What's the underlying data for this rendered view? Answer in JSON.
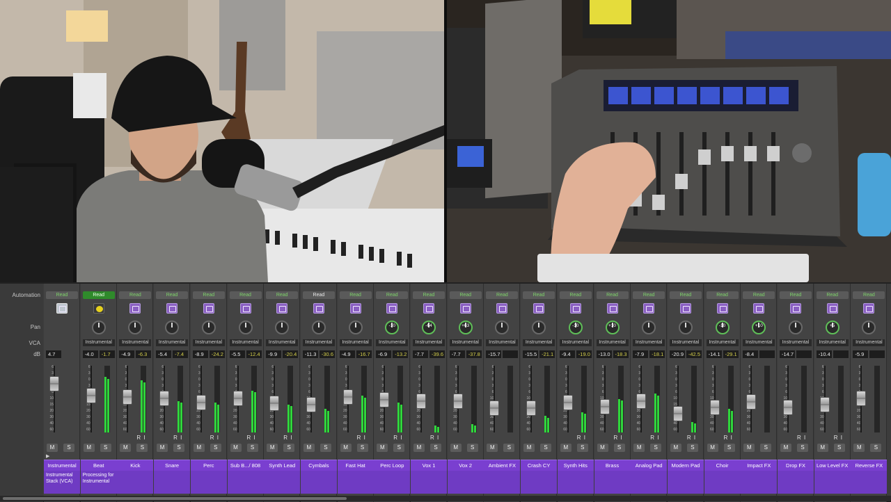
{
  "labels": {
    "automation": "Automation",
    "pan": "Pan",
    "vca": "VCA",
    "db": "dB"
  },
  "scale": [
    "6",
    "3",
    "0",
    "3",
    "6",
    "10",
    "15",
    "20",
    "30",
    "40",
    "60"
  ],
  "channels": [
    {
      "name": "Instrumental",
      "auto": "Read",
      "auto_style": "green-text",
      "plugin": "stack",
      "pan": "",
      "vca": "",
      "db1": "4.7",
      "db2": "",
      "fader": 0.27,
      "meter": [
        0,
        0
      ],
      "ri": false,
      "note": "Instrumental Stack (VCA)"
    },
    {
      "name": "Beat",
      "auto": "Read",
      "auto_style": "green-bg",
      "plugin": "beat",
      "pan": "",
      "vca": "Instrumental",
      "db1": "-4.0",
      "db2": "-1.7",
      "fader": 0.45,
      "meter": [
        0.83,
        0.8
      ],
      "ri": false,
      "note": "Processing for Instrumental"
    },
    {
      "name": "Kick",
      "auto": "Read",
      "auto_style": "green-text",
      "plugin": "plugin",
      "pan": "",
      "vca": "Instrumental",
      "db1": "-4.9",
      "db2": "-6.3",
      "fader": 0.47,
      "meter": [
        0.78,
        0.75
      ],
      "ri": true,
      "note": ""
    },
    {
      "name": "Snare",
      "auto": "Read",
      "auto_style": "green-text",
      "plugin": "plugin",
      "pan": "",
      "vca": "Instrumental",
      "db1": "-5.4",
      "db2": "-7.4",
      "fader": 0.49,
      "meter": [
        0.47,
        0.45
      ],
      "ri": true,
      "note": ""
    },
    {
      "name": "Perc",
      "auto": "Read",
      "auto_style": "green-text",
      "plugin": "plugin",
      "pan": "",
      "vca": "Instrumental",
      "db1": "-8.9",
      "db2": "-24.2",
      "fader": 0.55,
      "meter": [
        0.45,
        0.42
      ],
      "ri": true,
      "note": ""
    },
    {
      "name": "Sub B.../ 808",
      "auto": "Read",
      "auto_style": "green-text",
      "plugin": "plugin",
      "pan": "",
      "vca": "Instrumental",
      "db1": "-5.5",
      "db2": "-12.4",
      "fader": 0.49,
      "meter": [
        0.62,
        0.6
      ],
      "ri": true,
      "note": ""
    },
    {
      "name": "Synth Lead",
      "auto": "Read",
      "auto_style": "green-text",
      "plugin": "plugin",
      "pan": "",
      "vca": "Instrumental",
      "db1": "-9.9",
      "db2": "-20.4",
      "fader": 0.56,
      "meter": [
        0.42,
        0.4
      ],
      "ri": true,
      "note": ""
    },
    {
      "name": "Cymbals",
      "auto": "Read",
      "auto_style": "white",
      "plugin": "plugin",
      "pan": "",
      "vca": "Instrumental",
      "db1": "-11.3",
      "db2": "-30.6",
      "fader": 0.58,
      "meter": [
        0.35,
        0.32
      ],
      "ri": false,
      "note": ""
    },
    {
      "name": "Fast Hat",
      "auto": "Read",
      "auto_style": "green-text",
      "plugin": "plugin",
      "pan": "",
      "vca": "Instrumental",
      "db1": "-4.9",
      "db2": "-16.7",
      "fader": 0.47,
      "meter": [
        0.55,
        0.52
      ],
      "ri": true,
      "note": ""
    },
    {
      "name": "Perc Loop",
      "auto": "Read",
      "auto_style": "green-text",
      "plugin": "plugin",
      "pan": "-10",
      "vca": "Instrumental",
      "db1": "-6.9",
      "db2": "-13.2",
      "fader": 0.51,
      "meter": [
        0.45,
        0.42
      ],
      "ri": true,
      "note": ""
    },
    {
      "name": "Vox 1",
      "auto": "Read",
      "auto_style": "green-text",
      "plugin": "plugin",
      "pan": "-64",
      "vca": "Instrumental",
      "db1": "-7.7",
      "db2": "-39.6",
      "fader": 0.53,
      "meter": [
        0.1,
        0.08
      ],
      "ri": true,
      "note": ""
    },
    {
      "name": "Vox 2",
      "auto": "Read",
      "auto_style": "green-text",
      "plugin": "plugin",
      "pan": "+63",
      "vca": "Instrumental",
      "db1": "-7.7",
      "db2": "-37.8",
      "fader": 0.53,
      "meter": [
        0.12,
        0.1
      ],
      "ri": false,
      "note": ""
    },
    {
      "name": "Ambient FX",
      "auto": "Read",
      "auto_style": "green-text",
      "plugin": "plugin",
      "pan": "",
      "vca": "Instrumental",
      "db1": "-15.7",
      "db2": "",
      "fader": 0.64,
      "meter": [
        0,
        0
      ],
      "ri": false,
      "note": ""
    },
    {
      "name": "Crash CY",
      "auto": "Read",
      "auto_style": "green-text",
      "plugin": "plugin",
      "pan": "",
      "vca": "Instrumental",
      "db1": "-15.5",
      "db2": "-21.1",
      "fader": 0.64,
      "meter": [
        0.25,
        0.22
      ],
      "ri": false,
      "note": ""
    },
    {
      "name": "Synth Hits",
      "auto": "Read",
      "auto_style": "green-text",
      "plugin": "plugin",
      "pan": "-10",
      "vca": "Instrumental",
      "db1": "-9.4",
      "db2": "-19.0",
      "fader": 0.55,
      "meter": [
        0.3,
        0.28
      ],
      "ri": true,
      "note": ""
    },
    {
      "name": "Brass",
      "auto": "Read",
      "auto_style": "green-text",
      "plugin": "plugin",
      "pan": "+10",
      "vca": "Instrumental",
      "db1": "-13.0",
      "db2": "-18.3",
      "fader": 0.61,
      "meter": [
        0.5,
        0.48
      ],
      "ri": true,
      "note": ""
    },
    {
      "name": "Analog Pad",
      "auto": "Read",
      "auto_style": "green-text",
      "plugin": "plugin",
      "pan": "",
      "vca": "Instrumental",
      "db1": "-7.9",
      "db2": "-18.1",
      "fader": 0.53,
      "meter": [
        0.58,
        0.55
      ],
      "ri": true,
      "note": ""
    },
    {
      "name": "Modern Pad",
      "auto": "Read",
      "auto_style": "green-text",
      "plugin": "plugin",
      "pan": "",
      "vca": "Instrumental",
      "db1": "-20.9",
      "db2": "-42.5",
      "fader": 0.72,
      "meter": [
        0.16,
        0.14
      ],
      "ri": true,
      "note": ""
    },
    {
      "name": "Choir",
      "auto": "Read",
      "auto_style": "green-text",
      "plugin": "plugin",
      "pan": "-10",
      "vca": "Instrumental",
      "db1": "-14.1",
      "db2": "-29.1",
      "fader": 0.63,
      "meter": [
        0.35,
        0.32
      ],
      "ri": true,
      "note": ""
    },
    {
      "name": "Impact FX",
      "auto": "Read",
      "auto_style": "green-text",
      "plugin": "plugin",
      "pan": "+10",
      "vca": "Instrumental",
      "db1": "-8.4",
      "db2": "",
      "fader": 0.54,
      "meter": [
        0,
        0
      ],
      "ri": false,
      "note": ""
    },
    {
      "name": "Drop FX",
      "auto": "Read",
      "auto_style": "green-text",
      "plugin": "plugin",
      "pan": "",
      "vca": "Instrumental",
      "db1": "-14.7",
      "db2": "",
      "fader": 0.63,
      "meter": [
        0,
        0
      ],
      "ri": true,
      "note": ""
    },
    {
      "name": "Low Level FX",
      "auto": "Read",
      "auto_style": "green-text",
      "plugin": "plugin",
      "pan": "+5",
      "vca": "Instrumental",
      "db1": "-10.4",
      "db2": "",
      "fader": 0.58,
      "meter": [
        0,
        0
      ],
      "ri": true,
      "note": ""
    },
    {
      "name": "Reverse FX",
      "auto": "Read",
      "auto_style": "green-text",
      "plugin": "plugin",
      "pan": "",
      "vca": "Instrumental",
      "db1": "-5.9",
      "db2": "",
      "fader": 0.49,
      "meter": [
        0,
        0
      ],
      "ri": false,
      "note": ""
    }
  ],
  "buttons": {
    "mute": "M",
    "solo": "S",
    "record": "R",
    "input": "I"
  },
  "colors": {
    "track_purple": "#7a3fd0",
    "meter_green": "#2fd63b",
    "auto_green": "#7fd36b"
  }
}
